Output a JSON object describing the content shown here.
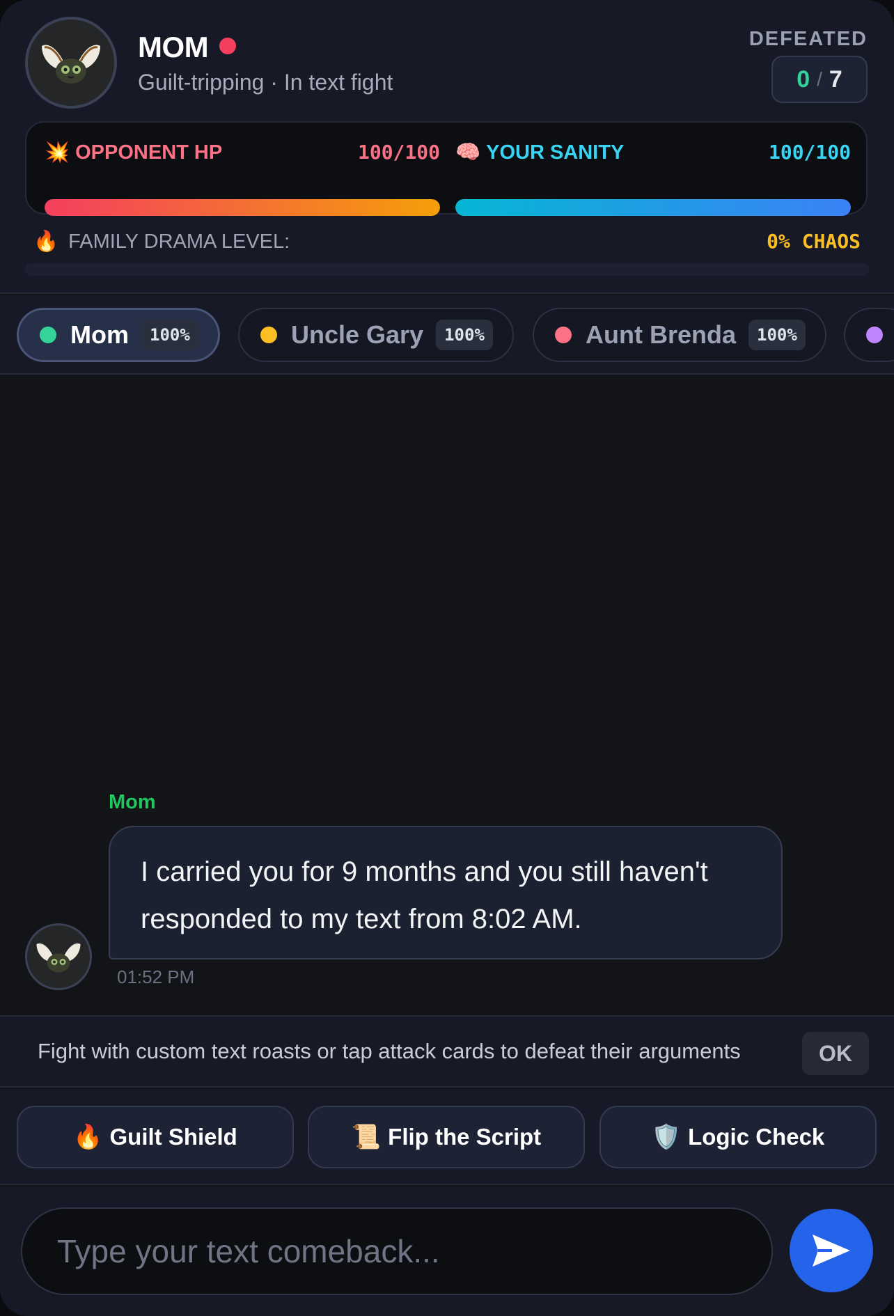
{
  "header": {
    "opponent_name": "MOM",
    "status_text": "Guilt-tripping · In text fight",
    "defeated_label": "DEFEATED",
    "defeated_count": "0",
    "defeated_separator": "/",
    "defeated_total": "7"
  },
  "stats": {
    "opponent_hp": {
      "icon": "💥",
      "label": "OPPONENT HP",
      "value_text": "100/100",
      "fraction": 1.0
    },
    "your_sanity": {
      "icon": "🧠",
      "label": "YOUR SANITY",
      "value_text": "100/100",
      "fraction": 1.0
    }
  },
  "drama": {
    "icon": "🔥",
    "label": "FAMILY DRAMA LEVEL:",
    "value_text": "0% CHAOS",
    "fraction": 0.0
  },
  "tabs": [
    {
      "name": "Mom",
      "pct": "100%",
      "dot_color": "#34d399",
      "active": true
    },
    {
      "name": "Uncle Gary",
      "pct": "100%",
      "dot_color": "#fbbf24",
      "active": false
    },
    {
      "name": "Aunt Brenda",
      "pct": "100%",
      "dot_color": "#fb7185",
      "active": false
    },
    {
      "name": "",
      "pct": "",
      "dot_color": "#c084fc",
      "active": false
    }
  ],
  "chat": {
    "messages": [
      {
        "sender": "Mom",
        "text": "I carried you for 9 months and you still haven't responded to my text from 8:02 AM.",
        "time": "01:52 PM"
      }
    ]
  },
  "hint": {
    "text": "Fight with custom text roasts or tap attack cards to defeat their arguments",
    "ok_label": "OK"
  },
  "attack_cards": [
    {
      "icon": "🔥",
      "label": "Guilt Shield"
    },
    {
      "icon": "📜",
      "label": "Flip the Script"
    },
    {
      "icon": "🛡️",
      "label": "Logic Check"
    }
  ],
  "composer": {
    "placeholder": "Type your text comeback...",
    "value": ""
  },
  "colors": {
    "accent_send": "#2563eb",
    "hp_red": "#fb7185",
    "sanity_cyan": "#38d4f4",
    "chaos_yellow": "#fbbf24",
    "sender_green": "#22c55e"
  },
  "icons": {
    "avatar": "cat-ears-avatar-icon",
    "send": "send-arrow-icon",
    "online": "online-status-dot"
  }
}
